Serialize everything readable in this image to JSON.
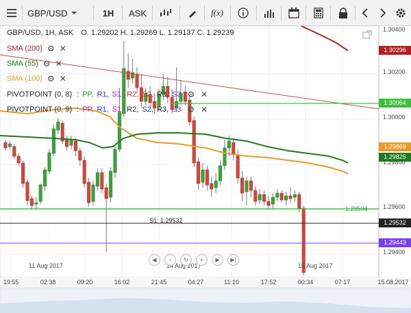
{
  "toolbar": {
    "symbol": "GBP/USD",
    "timeframe": "1H",
    "price_type": "ASK",
    "fx_label": "f(x)"
  },
  "header": {
    "info": "GBP/USD, 1H, ASK",
    "ohlc": "O. 1.29202 H. 1.29269 L. 1.29137 C. 1.29239"
  },
  "indicators": [
    {
      "label": "SMA (200)",
      "color": "#a52a2a"
    },
    {
      "label": "SMA (55)",
      "color": "#1a7a1a"
    },
    {
      "label": "SMA (100)",
      "color": "#e8a02a"
    }
  ],
  "pivots": [
    {
      "label": "PIVOTPOINT (0, 8)",
      "parts": [
        {
          "t": ":",
          "c": "#222"
        },
        {
          "t": "PP,",
          "c": "#16a016"
        },
        {
          "t": "R1,",
          "c": "#1e3fd0"
        },
        {
          "t": "S1,",
          "c": "#b01fb0"
        },
        {
          "t": "R2,",
          "c": "#d43030"
        },
        {
          "t": "S2,",
          "c": "#d43030"
        },
        {
          "t": "R3,",
          "c": "#222"
        },
        {
          "t": "S3",
          "c": "#8a2be2"
        }
      ]
    },
    {
      "label": "PIVOTPOINT (0, 9)",
      "parts": [
        {
          "t": ":",
          "c": "#222"
        },
        {
          "t": "PP,",
          "c": "#b01fb0"
        },
        {
          "t": "R1,",
          "c": "#1e3fd0"
        },
        {
          "t": "S1,",
          "c": "#b01fb0"
        },
        {
          "t": "R2,",
          "c": "#222"
        },
        {
          "t": "S2,",
          "c": "#1e3fd0"
        },
        {
          "t": "R3,",
          "c": "#222"
        },
        {
          "t": "S3",
          "c": "#8a2be2"
        }
      ]
    }
  ],
  "axis": {
    "y_labels": [
      "1.30400",
      "1.30200",
      "1.30000",
      "1.29800",
      "1.29600",
      "1.29400"
    ],
    "tags": [
      {
        "text": "1.30296",
        "price": 1.30296,
        "color": "#b02020"
      },
      {
        "text": "1.30064",
        "price": 1.30064,
        "color": "#3cc03c"
      },
      {
        "text": "1.29869",
        "price": 1.29869,
        "color": "#e89a2a"
      },
      {
        "text": "1.29825",
        "price": 1.29825,
        "color": "#1f7a1f"
      },
      {
        "text": "1.29532",
        "price": 1.29532,
        "color": "#222222"
      },
      {
        "text": "1.29443",
        "price": 1.29443,
        "color": "#7a3ff0"
      }
    ],
    "x_labels": [
      "19:55",
      "02:38",
      "09:20",
      "16:02",
      "21:45",
      "04:27",
      "11:10",
      "17:52",
      "00:34",
      "07:17",
      "15.08.2017"
    ],
    "dates": [
      "11 Aug 2017",
      "14 Aug 2017",
      "15 Aug 2017"
    ]
  },
  "levels": {
    "pp_text": "1.29594",
    "s1_text": "S1: 1.29532"
  }
}
